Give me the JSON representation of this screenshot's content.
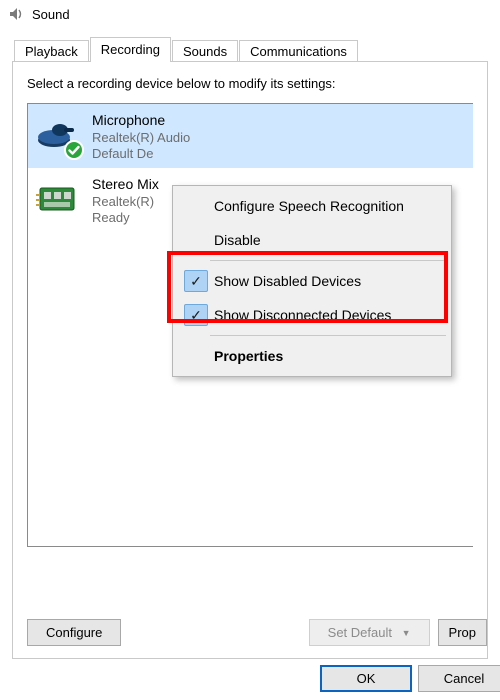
{
  "window": {
    "title": "Sound"
  },
  "tabs": {
    "playback": "Playback",
    "recording": "Recording",
    "sounds": "Sounds",
    "communications": "Communications"
  },
  "panel": {
    "instruction": "Select a recording device below to modify its settings:"
  },
  "devices": [
    {
      "name": "Microphone",
      "sub1": "Realtek(R) Audio",
      "sub2": "Default De"
    },
    {
      "name": "Stereo Mix",
      "sub1": "Realtek(R)",
      "sub2": "Ready"
    }
  ],
  "bottom": {
    "configure": "Configure",
    "set_default": "Set Default",
    "properties": "Prop"
  },
  "dialog": {
    "ok": "OK",
    "cancel": "Cancel"
  },
  "context_menu": {
    "configure_speech": "Configure Speech Recognition",
    "disable": "Disable",
    "show_disabled": "Show Disabled Devices",
    "show_disconnected": "Show Disconnected Devices",
    "properties": "Properties"
  }
}
